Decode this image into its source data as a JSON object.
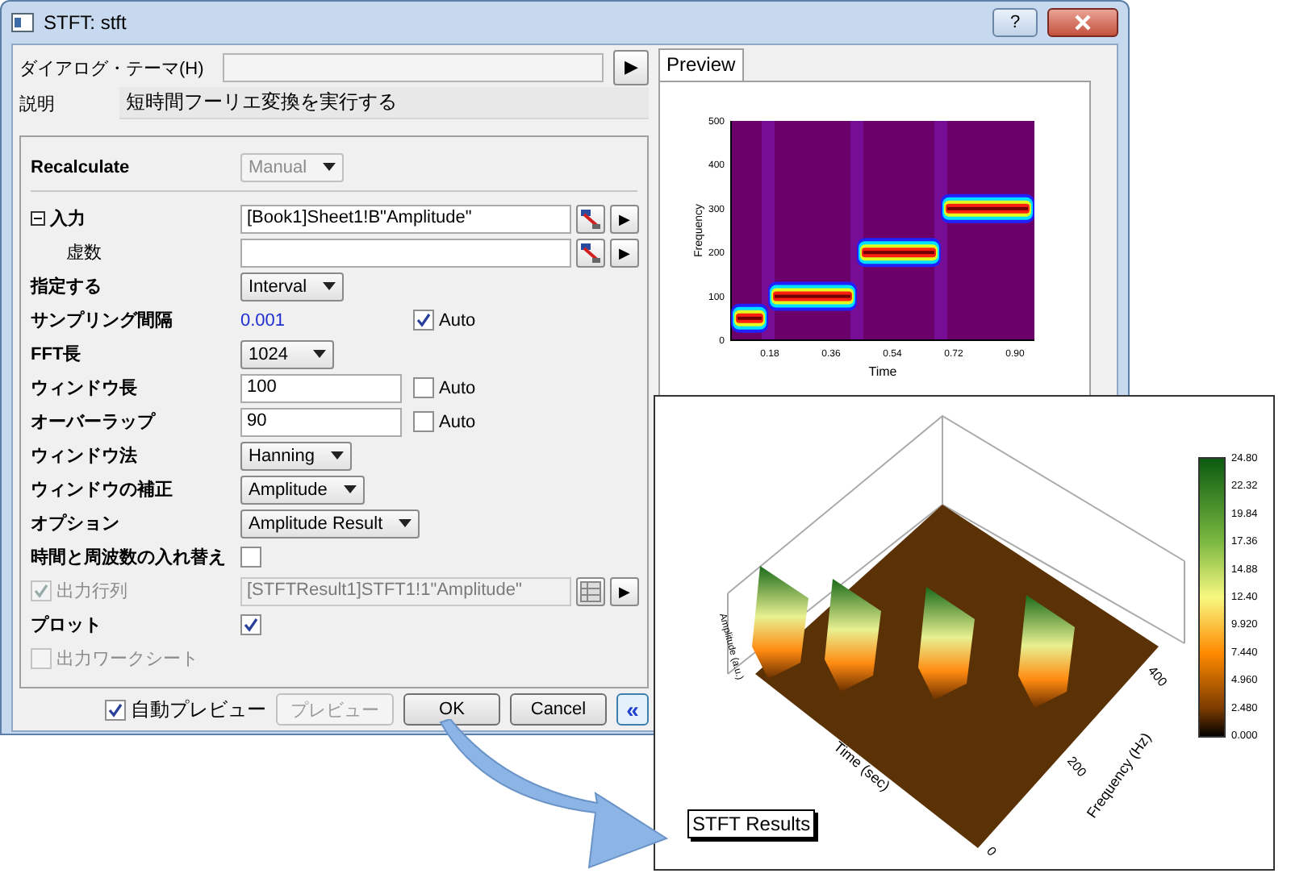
{
  "dialog": {
    "title": "STFT: stft",
    "help_button": "?",
    "theme": {
      "label": "ダイアログ・テーマ(H)",
      "button": "▶"
    },
    "description": {
      "label": "説明",
      "text": "短時間フーリエ変換を実行する"
    },
    "rows": [
      {
        "kind": "dropdown",
        "label": "Recalculate",
        "value": "Manual",
        "sub": false,
        "disabled": true
      },
      {
        "kind": "separator"
      },
      {
        "kind": "field",
        "label": "入力",
        "value": "[Book1]Sheet1!B\"Amplitude\"",
        "sub": false,
        "disabled": false,
        "expander": {
          "expanded": true
        },
        "menu_button": "▶"
      },
      {
        "kind": "field",
        "label": "虚数",
        "sub": true,
        "disabled": false,
        "menu_button": "▶"
      },
      {
        "kind": "dropdown",
        "label": "指定する",
        "value": "Interval",
        "sub": false,
        "disabled": false
      },
      {
        "kind": "text",
        "label": "サンプリング間隔",
        "value": "0.001",
        "sub": false,
        "disabled": false,
        "auto": {
          "label": "Auto",
          "checked": true
        }
      },
      {
        "kind": "dropdown",
        "label": "FFT長",
        "value": "1024",
        "sub": false,
        "disabled": false
      },
      {
        "kind": "field",
        "label": "ウィンドウ長",
        "value": "100",
        "sub": false,
        "disabled": false,
        "auto": {
          "label": "Auto",
          "checked": false
        }
      },
      {
        "kind": "field",
        "label": "オーバーラップ",
        "value": "90",
        "sub": false,
        "disabled": false,
        "auto": {
          "label": "Auto",
          "checked": false
        }
      },
      {
        "kind": "dropdown",
        "label": "ウィンドウ法",
        "value": "Hanning",
        "sub": false,
        "disabled": false
      },
      {
        "kind": "dropdown",
        "label": "ウィンドウの補正",
        "value": "Amplitude",
        "sub": false,
        "disabled": false
      },
      {
        "kind": "dropdown",
        "label": "オプション",
        "value": "Amplitude Result",
        "sub": false,
        "disabled": false
      },
      {
        "kind": "checkbox",
        "label": "時間と周波数の入れ替え",
        "checked": false,
        "sub": false,
        "disabled": false
      },
      {
        "kind": "field",
        "label": "出力行列",
        "value": "[STFTResult1]STFT1!1\"Amplitude\"",
        "sub": false,
        "disabled": true,
        "lead_check": {
          "checked": true
        },
        "menu_button": "▶"
      },
      {
        "kind": "checkbox",
        "label": "プロット",
        "checked": true,
        "sub": false,
        "disabled": false
      },
      {
        "kind": "label",
        "label": "出力ワークシート",
        "sub": false,
        "disabled": true,
        "lead_check": {
          "checked": false
        }
      }
    ],
    "footer": {
      "auto_preview": {
        "label": "自動プレビュー",
        "checked": true
      },
      "buttons": [
        {
          "label": "プレビュー",
          "disabled": true
        },
        {
          "label": "OK",
          "disabled": false
        },
        {
          "label": "Cancel",
          "disabled": false
        }
      ],
      "collapse_button": "«"
    }
  },
  "preview": {
    "tabs": [
      {
        "label": "Preview",
        "selected": true
      }
    ],
    "plot": {
      "xlabel": "Time",
      "ylabel": "Frequency",
      "xticks": [
        "0.18",
        "0.36",
        "0.54",
        "0.72",
        "0.90"
      ],
      "yticks": [
        "500",
        "400",
        "300",
        "200",
        "100",
        "0"
      ]
    }
  },
  "graph_window": {
    "colorbar_labels": [
      "24.80",
      "22.32",
      "19.84",
      "17.36",
      "14.88",
      "12.40",
      "9.920",
      "7.440",
      "4.960",
      "2.480",
      "0.000"
    ],
    "time_label": "Time (sec)",
    "frequency_label": "Frequency (Hz)",
    "amplitude_label": "Amplitude (a.u.)",
    "frequency_ticks": [
      "0",
      "200",
      "400"
    ],
    "legend": "STFT Results"
  }
}
